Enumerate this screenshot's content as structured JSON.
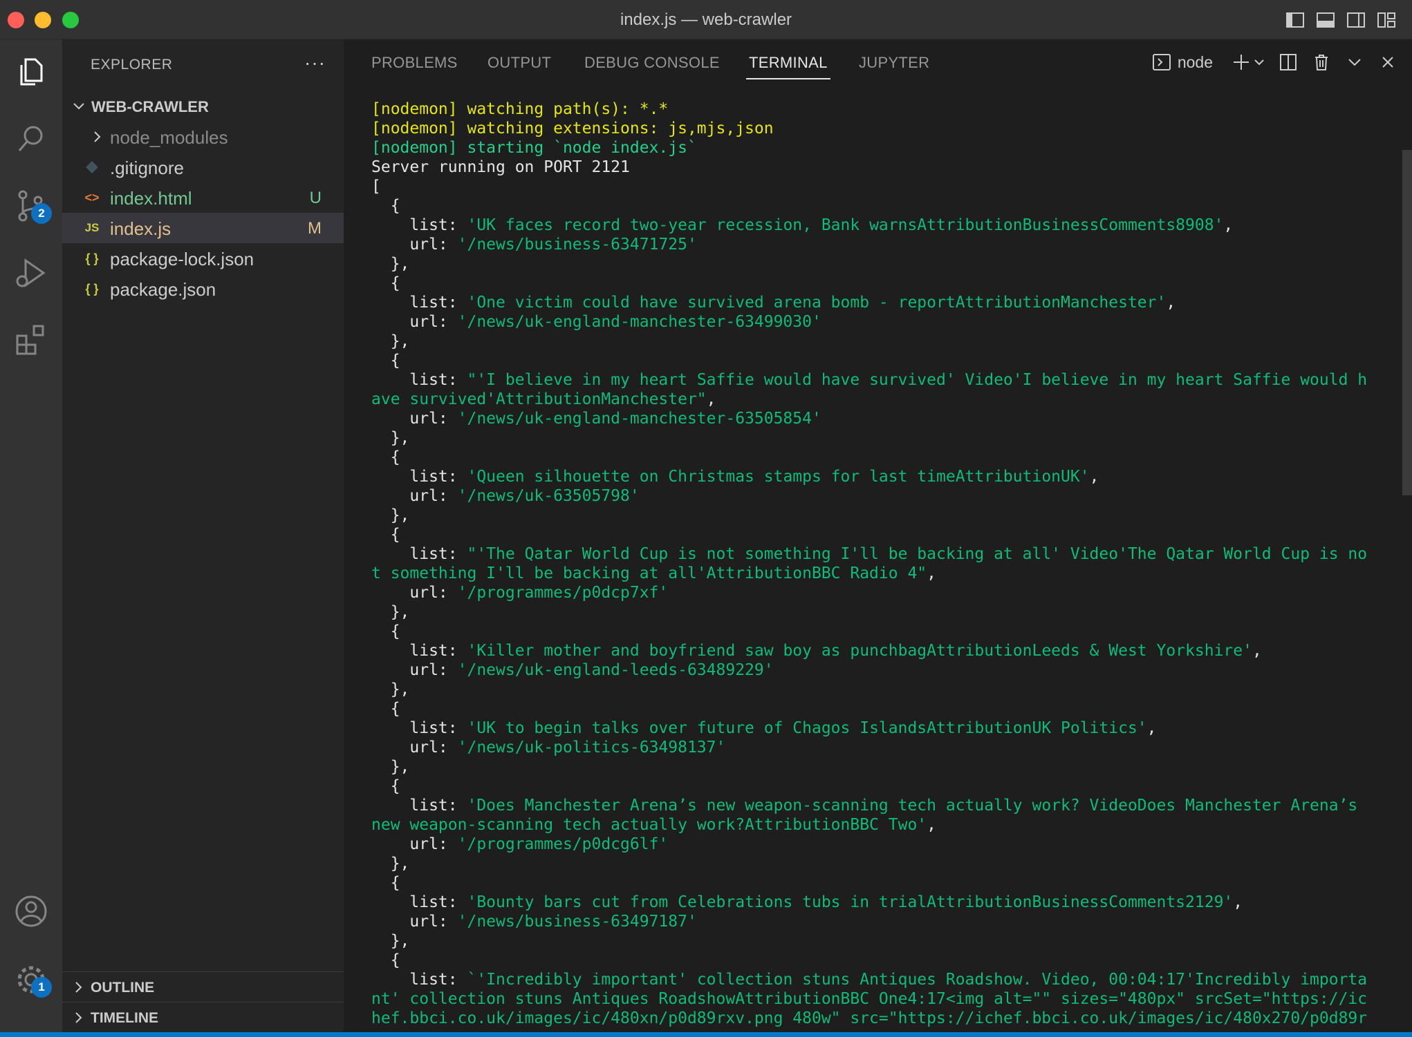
{
  "window": {
    "title": "index.js — web-crawler"
  },
  "activity_bar": {
    "items": [
      "explorer-icon",
      "search-icon",
      "source-control-icon",
      "run-debug-icon",
      "extensions-icon"
    ],
    "source_control_badge": "2",
    "settings_badge": "1"
  },
  "sidebar": {
    "header": "EXPLORER",
    "more": "···",
    "folder": "WEB-CRAWLER",
    "files": [
      {
        "name": "node_modules",
        "status": ""
      },
      {
        "name": ".gitignore",
        "status": ""
      },
      {
        "name": "index.html",
        "status": "U"
      },
      {
        "name": "index.js",
        "status": "M"
      },
      {
        "name": "package-lock.json",
        "status": ""
      },
      {
        "name": "package.json",
        "status": ""
      }
    ],
    "file_icons": {
      "js": "JS",
      "json": "{ }",
      "html": "<>"
    },
    "outline": "OUTLINE",
    "timeline": "TIMELINE"
  },
  "panel": {
    "tabs": [
      "PROBLEMS",
      "OUTPUT",
      "DEBUG CONSOLE",
      "TERMINAL",
      "JUPYTER"
    ],
    "active_tab": "TERMINAL",
    "terminal_name": "node"
  },
  "terminal": {
    "lines": [
      {
        "text": "[nodemon] watching path(s): *.*",
        "class": "yellow"
      },
      {
        "text": "[nodemon] watching extensions: js,mjs,json",
        "class": "yellow"
      },
      {
        "text": "[nodemon] starting `node index.js`",
        "class": "green"
      },
      {
        "text": "Server running on PORT 2121"
      },
      {
        "text": "["
      },
      {
        "text": "  {"
      },
      {
        "key": "    list: ",
        "val": "'UK faces record two-year recession, Bank warnsAttributionBusinessComments8908'",
        "tail": ","
      },
      {
        "key": "    url: ",
        "val": "'/news/business-63471725'"
      },
      {
        "text": "  },"
      },
      {
        "text": "  {"
      },
      {
        "key": "    list: ",
        "val": "'One victim could have survived arena bomb - reportAttributionManchester'",
        "tail": ","
      },
      {
        "key": "    url: ",
        "val": "'/news/uk-england-manchester-63499030'"
      },
      {
        "text": "  },"
      },
      {
        "text": "  {"
      },
      {
        "key": "    list: ",
        "val": "\"'I believe in my heart Saffie would have survived' Video'I believe in my heart Saffie would h"
      },
      {
        "val": "ave survived'AttributionManchester\"",
        "tail": ","
      },
      {
        "key": "    url: ",
        "val": "'/news/uk-england-manchester-63505854'"
      },
      {
        "text": "  },"
      },
      {
        "text": "  {"
      },
      {
        "key": "    list: ",
        "val": "'Queen silhouette on Christmas stamps for last timeAttributionUK'",
        "tail": ","
      },
      {
        "key": "    url: ",
        "val": "'/news/uk-63505798'"
      },
      {
        "text": "  },"
      },
      {
        "text": "  {"
      },
      {
        "key": "    list: ",
        "val": "\"'The Qatar World Cup is not something I'll be backing at all' Video'The Qatar World Cup is no"
      },
      {
        "val": "t something I'll be backing at all'AttributionBBC Radio 4\"",
        "tail": ","
      },
      {
        "key": "    url: ",
        "val": "'/programmes/p0dcp7xf'"
      },
      {
        "text": "  },"
      },
      {
        "text": "  {"
      },
      {
        "key": "    list: ",
        "val": "'Killer mother and boyfriend saw boy as punchbagAttributionLeeds & West Yorkshire'",
        "tail": ","
      },
      {
        "key": "    url: ",
        "val": "'/news/uk-england-leeds-63489229'"
      },
      {
        "text": "  },"
      },
      {
        "text": "  {"
      },
      {
        "key": "    list: ",
        "val": "'UK to begin talks over future of Chagos IslandsAttributionUK Politics'",
        "tail": ","
      },
      {
        "key": "    url: ",
        "val": "'/news/uk-politics-63498137'"
      },
      {
        "text": "  },"
      },
      {
        "text": "  {"
      },
      {
        "key": "    list: ",
        "val": "'Does Manchester Arena’s new weapon-scanning tech actually work? VideoDoes Manchester Arena’s"
      },
      {
        "val": "new weapon-scanning tech actually work?AttributionBBC Two'",
        "tail": ","
      },
      {
        "key": "    url: ",
        "val": "'/programmes/p0dcg6lf'"
      },
      {
        "text": "  },"
      },
      {
        "text": "  {"
      },
      {
        "key": "    list: ",
        "val": "'Bounty bars cut from Celebrations tubs in trialAttributionBusinessComments2129'",
        "tail": ","
      },
      {
        "key": "    url: ",
        "val": "'/news/business-63497187'"
      },
      {
        "text": "  },"
      },
      {
        "text": "  {"
      },
      {
        "key": "    list: ",
        "val": "`'Incredibly important' collection stuns Antiques Roadshow. Video, 00:04:17'Incredibly importa"
      },
      {
        "val": "nt' collection stuns Antiques RoadshowAttributionBBC One4:17<img alt=\"\" sizes=\"480px\" srcSet=\"https://ic"
      },
      {
        "val": "hef.bbci.co.uk/images/ic/480xn/p0d89rxv.png 480w\" src=\"https://ichef.bbci.co.uk/images/ic/480x270/p0d89r"
      }
    ]
  },
  "colors": {
    "accent": "#007acc",
    "untracked": "#73c991",
    "modified": "#e2c08d",
    "terminal_string": "#0dbc79",
    "terminal_yellow": "#e5e510"
  }
}
